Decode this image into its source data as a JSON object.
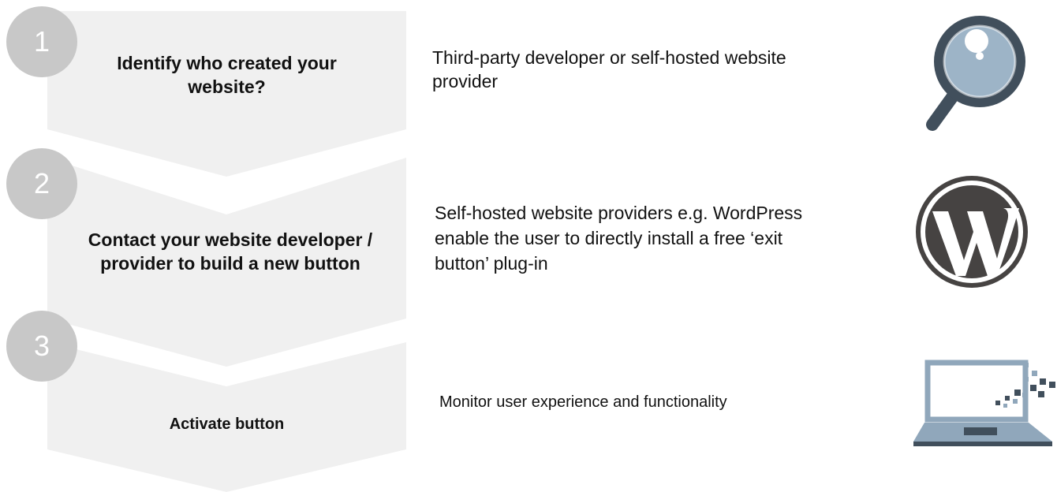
{
  "steps": [
    {
      "number": "1",
      "title": "Identify who created your website?",
      "description": "Third-party developer or self-hosted website provider",
      "icon": "magnifier-icon"
    },
    {
      "number": "2",
      "title": "Contact your website developer / provider to build a new button",
      "description": "Self-hosted website providers e.g. WordPress enable the user to directly install a free ‘exit button’ plug-in",
      "icon": "wordpress-icon"
    },
    {
      "number": "3",
      "title": "Activate button",
      "description": "Monitor user experience and functionality",
      "icon": "laptop-icon"
    }
  ],
  "colors": {
    "chevron_fill": "#f0f0f0",
    "circle_fill": "#c8c8c8",
    "icon_dark": "#414f5c",
    "icon_lens": "#9db4c7",
    "icon_laptop": "#90a7bb",
    "wordpress_dark": "#464342"
  }
}
